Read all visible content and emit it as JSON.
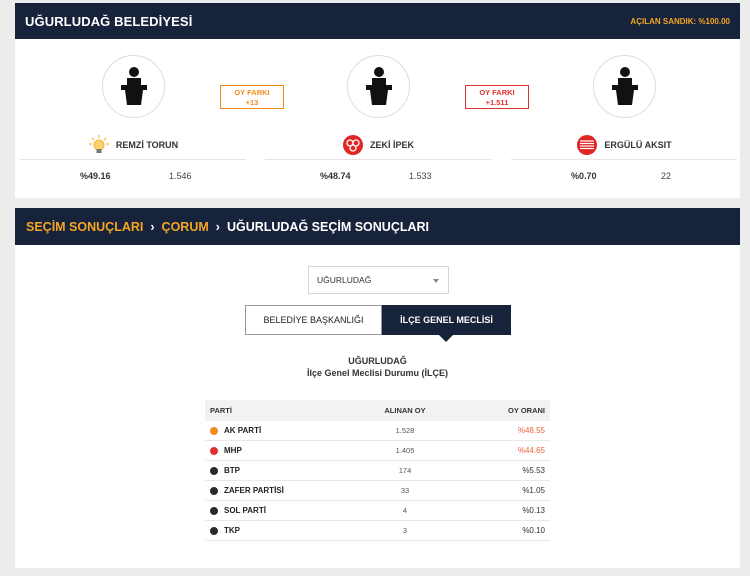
{
  "municipality": {
    "title": "UĞURLUDAĞ BELEDİYESİ",
    "opened_boxes": "AÇILAN SANDIK: %100.00"
  },
  "candidates": [
    {
      "name": "REMZİ TORUN",
      "percent": "%49.16",
      "votes": "1.546",
      "party_icon": "ak-parti-bulb-logo",
      "color": "#f39c12"
    },
    {
      "name": "ZEKİ İPEK",
      "percent": "%48.74",
      "votes": "1.533",
      "party_icon": "mhp-crescent-logo",
      "color": "#e03030"
    },
    {
      "name": "ERGÜLÜ AKSIT",
      "percent": "%0.70",
      "votes": "22",
      "party_icon": "chp-six-arrows-logo",
      "color": "#e03030"
    }
  ],
  "vote_diffs": [
    {
      "label": "OY FARKI",
      "value": "+13"
    },
    {
      "label": "OY FARKI",
      "value": "+1.511"
    }
  ],
  "results_header": {
    "crumb1": "SEÇİM SONUÇLARI",
    "crumb2": "ÇORUM",
    "crumb3": "UĞURLUDAĞ SEÇİM SONUÇLARI"
  },
  "district_select": {
    "value": "UĞURLUDAĞ"
  },
  "tabs": [
    {
      "label": "BELEDİYE BAŞKANLIĞI",
      "active": false
    },
    {
      "label": "İLÇE GENEL MECLİSİ",
      "active": true
    }
  ],
  "table_title": {
    "line1": "UĞURLUDAĞ",
    "line2": "İlçe Genel Meclisi Durumu (İLÇE)"
  },
  "table": {
    "headers": [
      "PARTİ",
      "ALINAN OY",
      "OY ORANI"
    ],
    "rows": [
      {
        "party": "AK PARTİ",
        "votes": "1.528",
        "rate": "%48.55",
        "color": "#f08c1a",
        "highlight": true
      },
      {
        "party": "MHP",
        "votes": "1.405",
        "rate": "%44.65",
        "color": "#e03030",
        "highlight": true
      },
      {
        "party": "BTP",
        "votes": "174",
        "rate": "%5.53",
        "color": "#2a2a2a",
        "highlight": false
      },
      {
        "party": "ZAFER PARTİSİ",
        "votes": "33",
        "rate": "%1.05",
        "color": "#2a2a2a",
        "highlight": false
      },
      {
        "party": "SOL PARTİ",
        "votes": "4",
        "rate": "%0.13",
        "color": "#2a2a2a",
        "highlight": false
      },
      {
        "party": "TKP",
        "votes": "3",
        "rate": "%0.10",
        "color": "#2a2a2a",
        "highlight": false
      }
    ]
  }
}
